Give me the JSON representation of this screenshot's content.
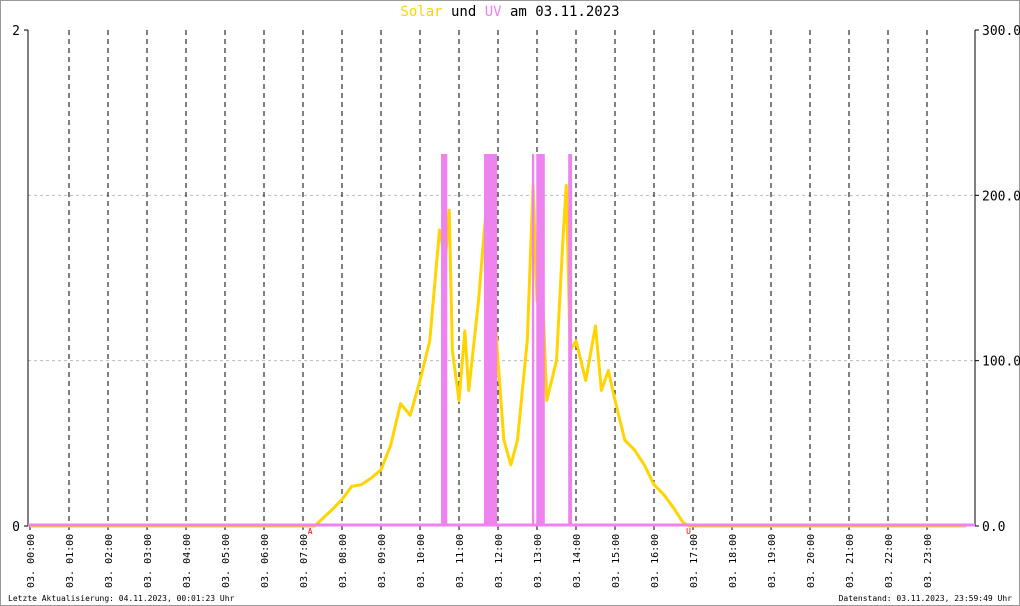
{
  "chart_data": {
    "type": "line",
    "title": {
      "part1": "Solar",
      "part2": " und ",
      "part3": "UV",
      "part4": " am 03.11.2023"
    },
    "colors": {
      "solar": "#ffd400",
      "uv": "#ee82ee",
      "marker": "#ff0000"
    },
    "x_unit": "hours",
    "xlim": [
      0,
      24
    ],
    "x_tick_labels": [
      "03. 00:00",
      "03. 01:00",
      "03. 02:00",
      "03. 03:00",
      "03. 04:00",
      "03. 05:00",
      "03. 06:00",
      "03. 07:00",
      "03. 08:00",
      "03. 09:00",
      "03. 10:00",
      "03. 11:00",
      "03. 12:00",
      "03. 13:00",
      "03. 14:00",
      "03. 15:00",
      "03. 16:00",
      "03. 17:00",
      "03. 18:00",
      "03. 19:00",
      "03. 20:00",
      "03. 21:00",
      "03. 22:00",
      "03. 23:00"
    ],
    "left_axis": {
      "label": "UV",
      "ylim": [
        0,
        2
      ],
      "tick_labels": [
        "0",
        "2"
      ]
    },
    "right_axis": {
      "label": "Solar",
      "ylim": [
        0,
        300
      ],
      "tick_labels": [
        "0.0",
        "100.0",
        "200.0",
        "300.0"
      ]
    },
    "markers": [
      {
        "label": "A",
        "x": 7.2
      },
      {
        "label": "U",
        "x": 16.9
      }
    ],
    "series": [
      {
        "name": "Solar",
        "axis": "right",
        "points": [
          [
            0,
            0
          ],
          [
            7.3,
            0
          ],
          [
            7.75,
            10
          ],
          [
            8,
            16
          ],
          [
            8.25,
            24
          ],
          [
            8.5,
            25
          ],
          [
            8.75,
            29
          ],
          [
            9,
            34
          ],
          [
            9.25,
            49
          ],
          [
            9.5,
            74
          ],
          [
            9.75,
            67
          ],
          [
            10,
            88
          ],
          [
            10.25,
            112
          ],
          [
            10.5,
            179
          ],
          [
            10.65,
            161
          ],
          [
            10.75,
            191
          ],
          [
            10.83,
            106
          ],
          [
            11,
            76
          ],
          [
            11.15,
            118
          ],
          [
            11.25,
            82
          ],
          [
            11.5,
            136
          ],
          [
            11.65,
            179
          ],
          [
            11.75,
            202
          ],
          [
            11.9,
            136
          ],
          [
            12,
            100
          ],
          [
            12.15,
            52
          ],
          [
            12.33,
            37
          ],
          [
            12.5,
            52
          ],
          [
            12.75,
            112
          ],
          [
            12.9,
            206
          ],
          [
            13,
            136
          ],
          [
            13.08,
            179
          ],
          [
            13.25,
            76
          ],
          [
            13.5,
            100
          ],
          [
            13.65,
            167
          ],
          [
            13.75,
            206
          ],
          [
            13.85,
            106
          ],
          [
            14,
            112
          ],
          [
            14.25,
            88
          ],
          [
            14.5,
            121
          ],
          [
            14.65,
            82
          ],
          [
            14.83,
            94
          ],
          [
            15,
            76
          ],
          [
            15.25,
            52
          ],
          [
            15.5,
            46
          ],
          [
            15.75,
            37
          ],
          [
            16,
            25
          ],
          [
            16.25,
            19
          ],
          [
            16.5,
            11
          ],
          [
            16.75,
            2
          ],
          [
            16.9,
            0
          ],
          [
            24,
            0
          ]
        ]
      },
      {
        "name": "UV",
        "axis": "left",
        "bars": [
          [
            10.54,
            10.7,
            1.5
          ],
          [
            11.64,
            11.98,
            1.5
          ],
          [
            12.87,
            12.93,
            1.5
          ],
          [
            12.98,
            13.2,
            1.5
          ],
          [
            13.8,
            13.9,
            1.5
          ]
        ]
      }
    ]
  },
  "footer": {
    "left": "Letzte Aktualisierung: 04.11.2023, 00:01:23 Uhr",
    "right": "Datenstand: 03.11.2023, 23:59:49 Uhr"
  }
}
